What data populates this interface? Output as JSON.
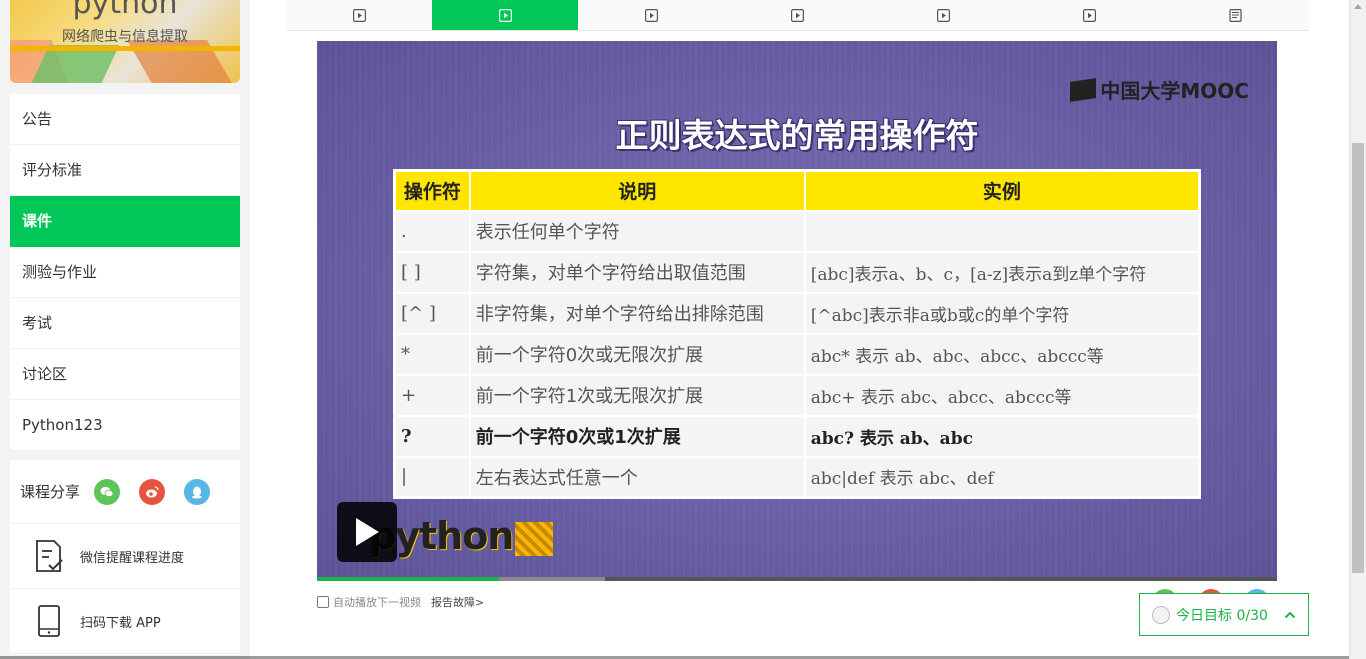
{
  "course": {
    "banner_title": "python",
    "banner_subtitle": "网络爬虫与信息提取"
  },
  "sidebar": {
    "items": [
      {
        "label": "公告"
      },
      {
        "label": "评分标准"
      },
      {
        "label": "课件",
        "active": true
      },
      {
        "label": "测验与作业"
      },
      {
        "label": "考试"
      },
      {
        "label": "讨论区"
      },
      {
        "label": "Python123"
      }
    ],
    "share": {
      "label": "课程分享",
      "icons": [
        "wechat-icon",
        "weibo-icon",
        "qq-icon"
      ],
      "colors": {
        "wechat": "#5dc35a",
        "weibo": "#e8533f",
        "qq": "#56b6e6"
      }
    },
    "tools": [
      {
        "label": "微信提醒课程进度",
        "icon": "checklist-icon"
      },
      {
        "label": "扫码下载 APP",
        "icon": "phone-icon"
      }
    ]
  },
  "unit_tabs": [
    {
      "icon": "video-icon"
    },
    {
      "icon": "video-icon",
      "active": true
    },
    {
      "icon": "video-icon"
    },
    {
      "icon": "video-icon"
    },
    {
      "icon": "video-icon"
    },
    {
      "icon": "video-icon"
    },
    {
      "icon": "document-icon"
    }
  ],
  "video": {
    "logo_text": "中国大学MOOC",
    "slide_title": "正则表达式的常用操作符",
    "table_headers": [
      "操作符",
      "说明",
      "实例"
    ],
    "table_rows": [
      {
        "op": ".",
        "desc": "表示任何单个字符",
        "example": ""
      },
      {
        "op": "[ ]",
        "desc": "字符集，对单个字符给出取值范围",
        "example": "[abc]表示a、b、c，[a-z]表示a到z单个字符"
      },
      {
        "op": "[^ ]",
        "desc": "非字符集，对单个字符给出排除范围",
        "example": "[^abc]表示非a或b或c的单个字符"
      },
      {
        "op": "*",
        "desc": "前一个字符0次或无限次扩展",
        "example": "abc* 表示 ab、abc、abcc、abccc等"
      },
      {
        "op": "+",
        "desc": "前一个字符1次或无限次扩展",
        "example": "abc+ 表示 abc、abcc、abccc等"
      },
      {
        "op": "?",
        "desc": "前一个字符0次或1次扩展",
        "example": "abc? 表示 ab、abc",
        "bold": true
      },
      {
        "op": "|",
        "desc": "左右表达式任意一个",
        "example": "abc|def 表示 abc、def"
      }
    ],
    "corner_logo_text": "python",
    "progress_played": 0.19,
    "progress_buffered": 0.3
  },
  "below_video": {
    "autoplay_label": "自动播放下一视频",
    "report_label": "报告故障>"
  },
  "goal": {
    "label": "今日目标 0/30"
  },
  "colors": {
    "accent": "#00c758",
    "goal_green": "#1bb24b",
    "table_header": "#ffe600"
  }
}
